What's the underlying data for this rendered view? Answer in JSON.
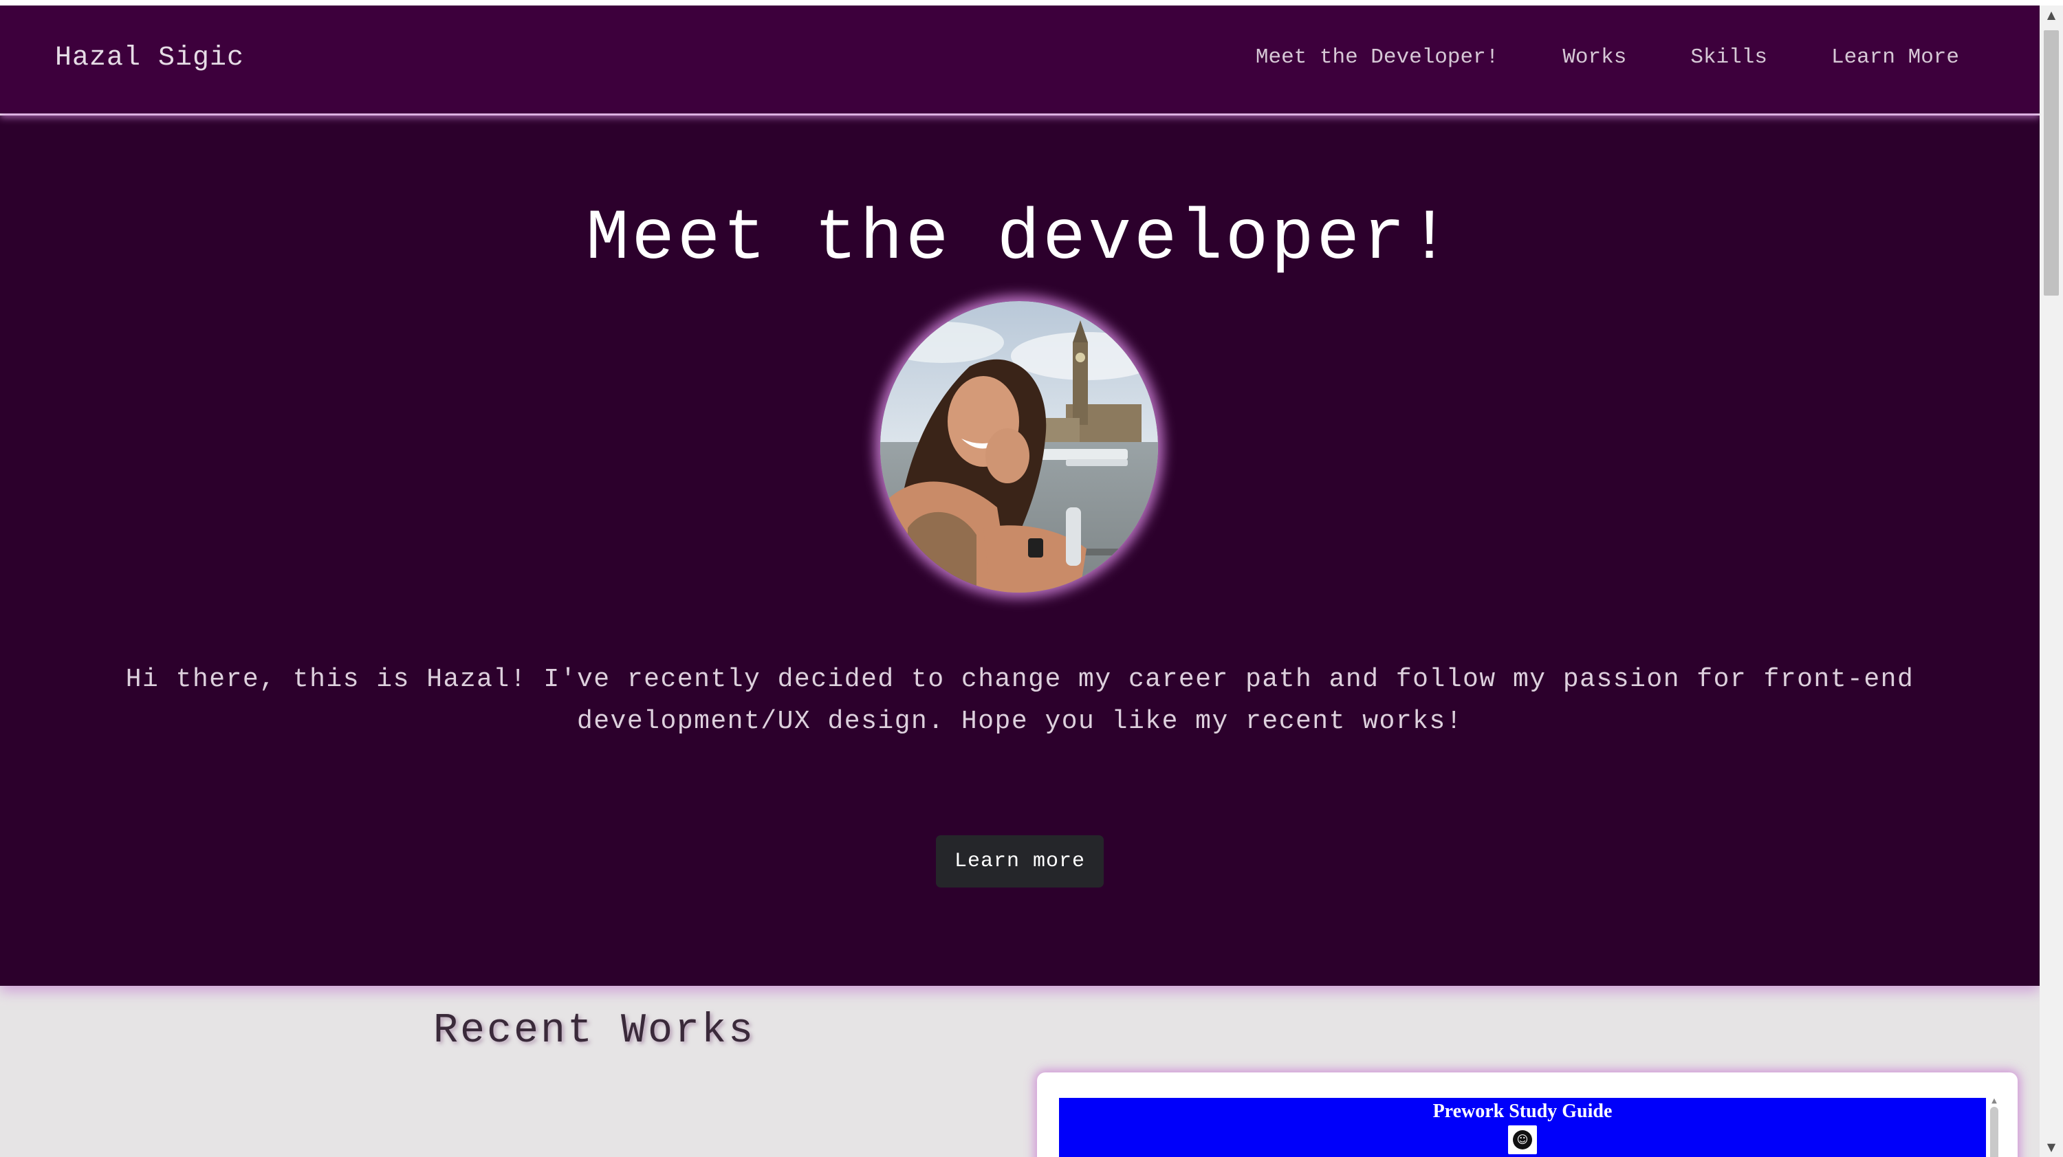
{
  "navbar": {
    "brand": "Hazal Sigic",
    "links": [
      "Meet the Developer!",
      "Works",
      "Skills",
      "Learn More"
    ]
  },
  "hero": {
    "title": "Meet the developer!",
    "description": "Hi there, this is Hazal! I've recently decided to change my career path and follow my passion for front-end development/UX design. Hope you like my recent works!",
    "button_label": "Learn more",
    "avatar_alt": "profile-photo"
  },
  "recent_works": {
    "title": "Recent Works",
    "cards": [
      {
        "preview_title": "Prework Study Guide"
      }
    ]
  },
  "colors": {
    "nav_bg": "#3d003c",
    "hero_bg": "#2c002c",
    "page_bg": "#e6e4e5",
    "button_bg": "#25262a",
    "glow": "#d68ce0",
    "preview_bg": "#0000fa"
  },
  "icons": {
    "scroll_up": "▲",
    "scroll_down": "▼",
    "preview_logo": "github-icon"
  }
}
